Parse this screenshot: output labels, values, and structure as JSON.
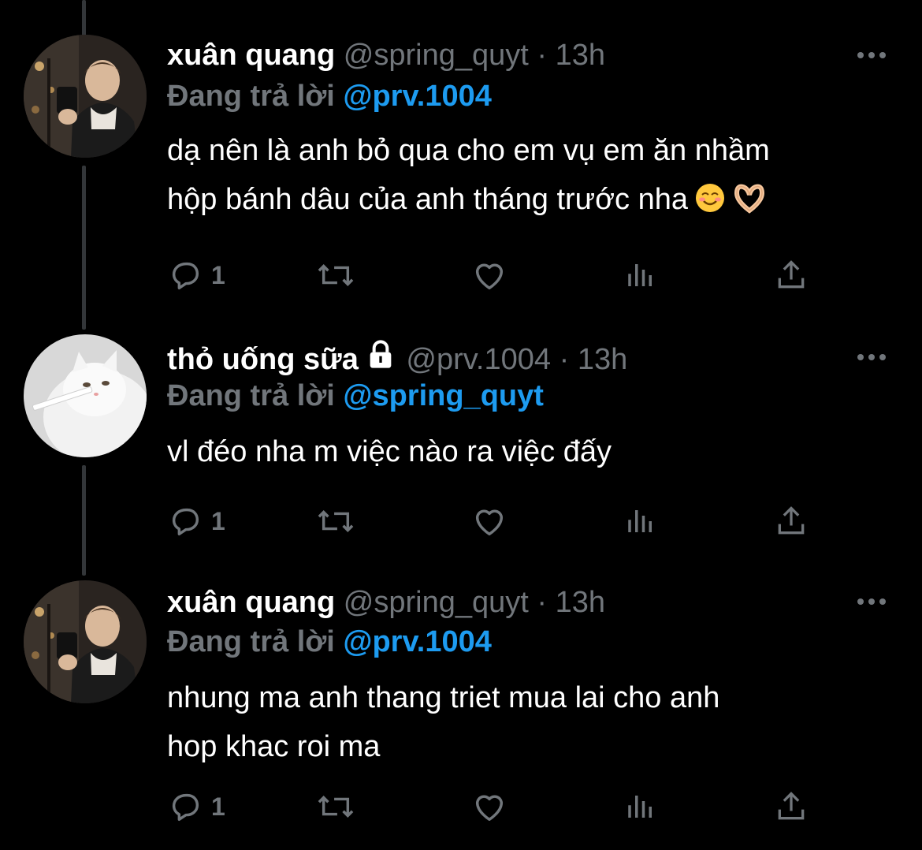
{
  "thread": [
    {
      "author_name": "xuân quang",
      "handle": "@spring_quyt",
      "separator": "·",
      "time": "13h",
      "locked": false,
      "reply_prefix": "Đang trả lời",
      "reply_to": "@prv.1004",
      "text_lines": [
        "dạ nên là anh bỏ qua cho em vụ em ăn nhầm",
        "hộp bánh dâu của anh tháng trước nha"
      ],
      "emoji": [
        "smiling-face-emoji",
        "heart-hands-emoji"
      ],
      "reply_count": "1",
      "avatar": "person-photo"
    },
    {
      "author_name": "thỏ uống sữa",
      "handle": "@prv.1004",
      "separator": "·",
      "time": "13h",
      "locked": true,
      "reply_prefix": "Đang trả lời",
      "reply_to": "@spring_quyt",
      "text_lines": [
        "vl đéo nha m việc nào ra việc đấy"
      ],
      "emoji": [],
      "reply_count": "1",
      "avatar": "white-cat-photo"
    },
    {
      "author_name": "xuân quang",
      "handle": "@spring_quyt",
      "separator": "·",
      "time": "13h",
      "locked": false,
      "reply_prefix": "Đang trả lời",
      "reply_to": "@prv.1004",
      "text_lines": [
        "nhung ma anh thang triet mua lai cho anh",
        "hop khac roi ma"
      ],
      "emoji": [],
      "reply_count": "1",
      "avatar": "person-photo"
    }
  ],
  "colors": {
    "background": "#000000",
    "text": "#ffffff",
    "secondary": "#71767b",
    "link": "#1d9bf0",
    "thread_line": "#333639"
  },
  "icons": {
    "reply": "reply-icon",
    "retweet": "retweet-icon",
    "like": "heart-icon",
    "views": "views-icon",
    "share": "share-icon",
    "more": "more-icon",
    "lock": "lock-icon"
  }
}
